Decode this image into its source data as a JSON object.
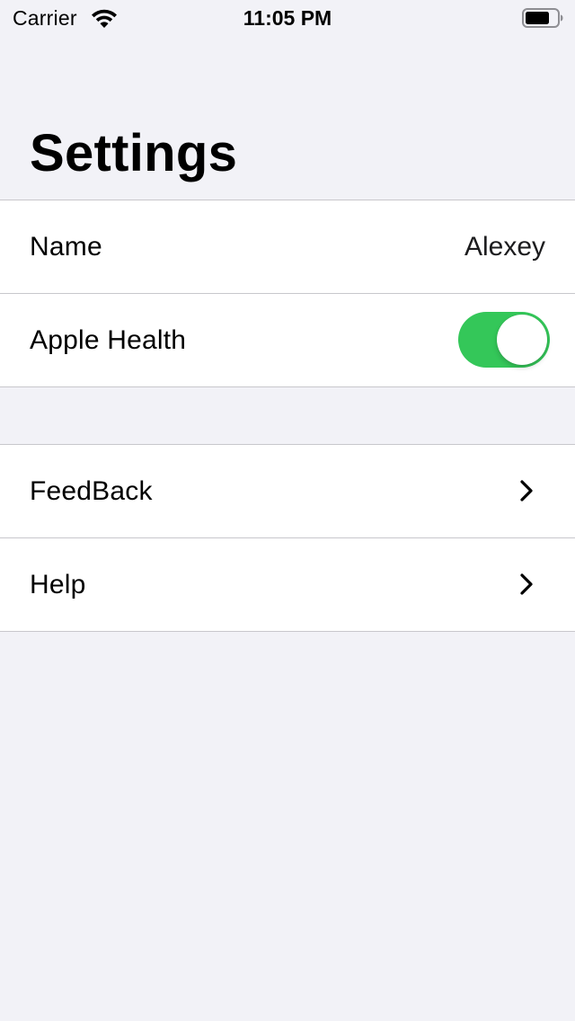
{
  "status_bar": {
    "carrier": "Carrier",
    "time": "11:05 PM",
    "wifi_icon": "wifi-icon",
    "battery_icon": "battery-icon"
  },
  "header": {
    "title": "Settings"
  },
  "sections": [
    {
      "rows": [
        {
          "label": "Name",
          "value": "Alexey"
        },
        {
          "label": "Apple Health",
          "toggle_on": true,
          "toggle_color": "#34c759"
        }
      ]
    },
    {
      "rows": [
        {
          "label": "FeedBack",
          "icon": "chevron-right-icon"
        },
        {
          "label": "Help",
          "icon": "chevron-right-icon"
        }
      ]
    }
  ],
  "colors": {
    "background": "#f2f2f7",
    "cell_background": "#ffffff",
    "separator": "#c8c7cc",
    "toggle_on": "#34c759"
  }
}
